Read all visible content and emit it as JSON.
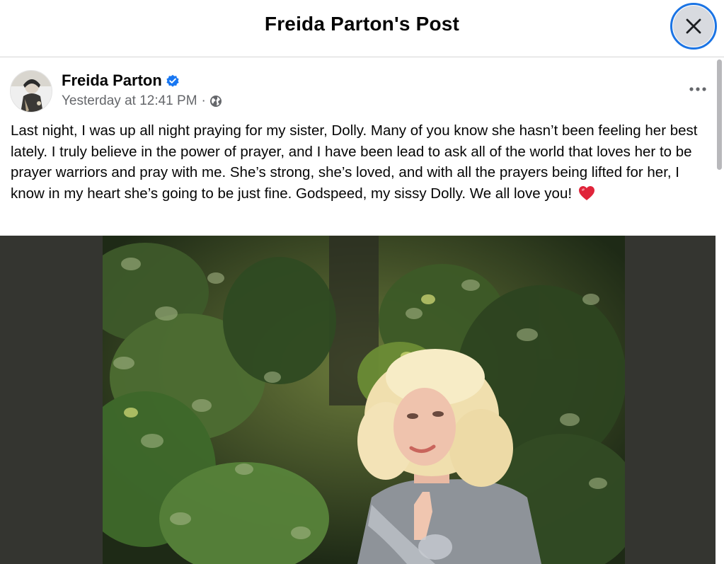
{
  "header": {
    "title": "Freida Parton's Post"
  },
  "close_icon": "close-icon",
  "post": {
    "author": "Freida Parton",
    "timestamp": "Yesterday at 12:41 PM",
    "separator": "·",
    "privacy_icon": "globe-icon",
    "verified_icon": "verified-badge-icon",
    "more_icon": "more-options-icon",
    "text": "Last night, I was up all night praying for my sister, Dolly. Many of you know she hasn’t been feeling her best lately. I truly believe in the power of prayer, and I have been lead to ask all of the world that loves her to be prayer warriors and pray with me. She’s strong, she’s loved, and with all the prayers being lifted for her, I know in my heart she’s going to be just fine. Godspeed, my sissy Dolly. We all love you!",
    "emoji": "heart-icon"
  },
  "colors": {
    "accent": "#1b74e4",
    "verified": "#1877f2",
    "secondary_text": "#65676b",
    "photo_backdrop": "#343530",
    "heart": "#e0243a"
  }
}
